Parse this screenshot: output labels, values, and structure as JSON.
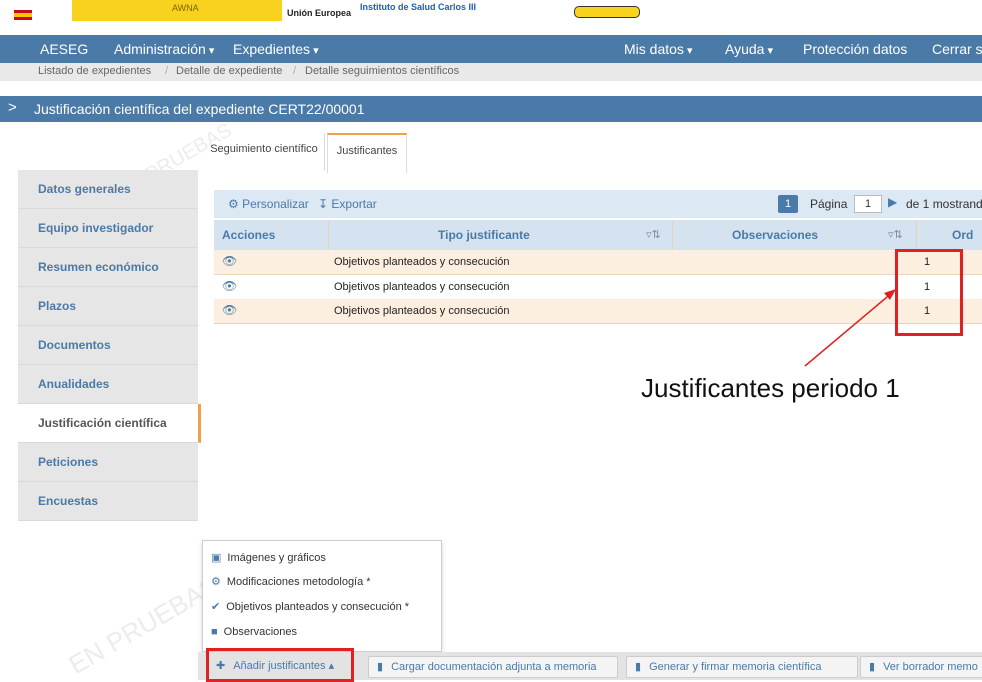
{
  "banner": {
    "text_left": "AWNA",
    "eu_label": "Unión Europea",
    "institute": "Instituto de Salud Carlos III"
  },
  "navbar": {
    "brand": "AESEG",
    "admin": "Administración",
    "files": "Expedientes",
    "my_data": "Mis datos",
    "help": "Ayuda",
    "data_protection": "Protección datos",
    "logout": "Cerrar s"
  },
  "breadcrumb": [
    "Listado de expedientes",
    "Detalle de expediente",
    "Detalle seguimientos científicos"
  ],
  "title": "Justificación científica del expediente CERT22/00001",
  "tabs": [
    "Seguimiento científico",
    "Justificantes"
  ],
  "sidebar": [
    "Datos generales",
    "Equipo investigador",
    "Resumen económico",
    "Plazos",
    "Documentos",
    "Anualidades",
    "Justificación científica",
    "Peticiones",
    "Encuestas"
  ],
  "grid": {
    "customize": "Personalizar",
    "export": "Exportar",
    "page_current": "1",
    "page_label": "Página",
    "page_input": "1",
    "page_of": "de 1  mostrand",
    "headers": [
      "Acciones",
      "Tipo justificante",
      "Observaciones",
      "Ord"
    ],
    "rows": [
      {
        "tipo": "Objetivos planteados y consecución",
        "obs": "",
        "ord": "1"
      },
      {
        "tipo": "Objetivos planteados y consecución",
        "obs": "",
        "ord": "1"
      },
      {
        "tipo": "Objetivos planteados y consecución",
        "obs": "",
        "ord": "1"
      }
    ]
  },
  "annotation": "Justificantes periodo 1",
  "menu": [
    "Imágenes y gráficos",
    "Modificaciones metodología *",
    "Objetivos planteados y consecución *",
    "Observaciones"
  ],
  "bottom": {
    "add": "Añadir justificantes",
    "load": "Cargar documentación adjunta a memoria",
    "sign": "Generar y firmar memoria científica",
    "draft": "Ver borrador memo"
  },
  "watermark": "EN PRUEBAS",
  "colors": {
    "primary": "#4a7aa7",
    "accent": "#f0a04b",
    "row_bg": "#fcefdf",
    "highlight": "#e0211f"
  }
}
